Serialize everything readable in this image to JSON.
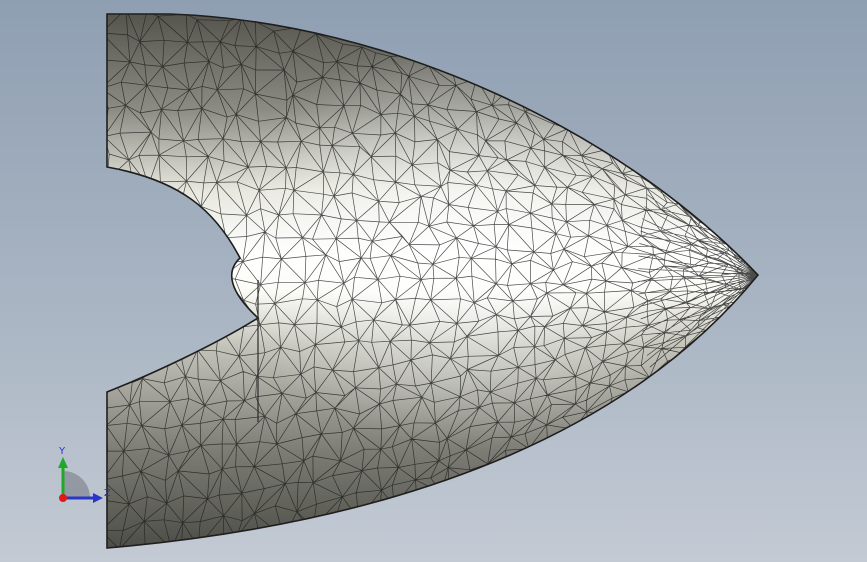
{
  "viewport": {
    "view": "3d-model-viewport",
    "background_colors": [
      "#8f9fb2",
      "#c3cad4"
    ]
  },
  "model": {
    "representation": "triangulated-surface-mesh",
    "shape": "paraboloid-nose-cone-with-cylindrical-cutout",
    "surface_color": "#bdbdb5",
    "highlight_color": "#ffffff",
    "edge_color": "#1e1e1e"
  },
  "triad": {
    "y_label": "Y",
    "z_label": "Z",
    "y_color": "#1fa82a",
    "z_color": "#2a36c8",
    "origin_color": "#e01818"
  }
}
